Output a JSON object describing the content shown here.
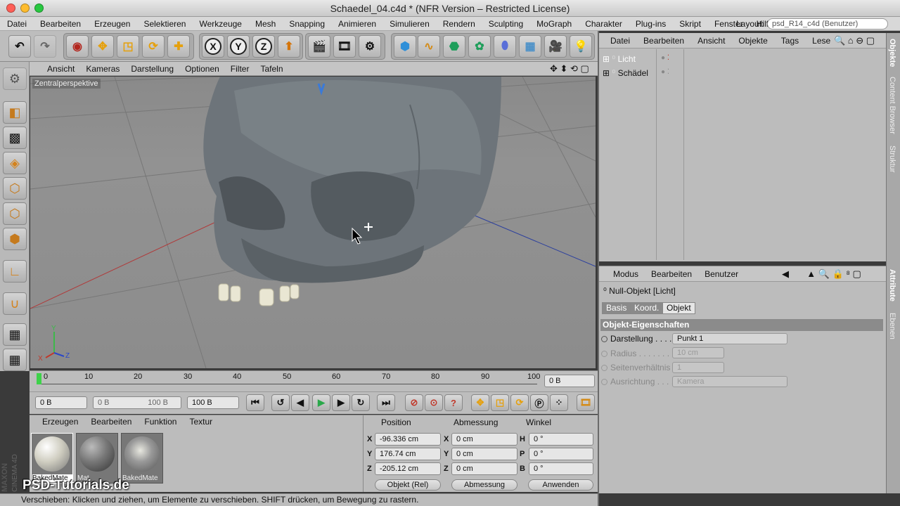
{
  "window": {
    "title": "Schaedel_04.c4d * (NFR Version – Restricted License)"
  },
  "menubar": {
    "items": [
      "Datei",
      "Bearbeiten",
      "Erzeugen",
      "Selektieren",
      "Werkzeuge",
      "Mesh",
      "Snapping",
      "Animieren",
      "Simulieren",
      "Rendern",
      "Sculpting",
      "MoGraph",
      "Charakter",
      "Plug-ins",
      "Skript",
      "Fenster",
      "Hilfe"
    ],
    "layout_label": "Layout:",
    "layout_value": "psd_R14_c4d (Benutzer)"
  },
  "toolbar": {
    "icons": [
      "undo-icon",
      "redo-icon",
      "select-icon",
      "move-icon",
      "scale-icon",
      "rotate-icon",
      "live-select-icon",
      "x-axis-icon",
      "y-axis-icon",
      "z-axis-icon",
      "coordinate-system-icon",
      "render-view-icon",
      "render-picture-viewer-icon",
      "render-settings-icon",
      "cube-icon",
      "spline-icon",
      "subdivision-icon",
      "array-icon",
      "deformer-icon",
      "floor-icon",
      "camera-icon",
      "light-icon"
    ],
    "axis_labels": [
      "X",
      "Y",
      "Z"
    ]
  },
  "viewport": {
    "menu": [
      "Ansicht",
      "Kameras",
      "Darstellung",
      "Optionen",
      "Filter",
      "Tafeln"
    ],
    "label": "Zentralperspektive",
    "axis_labels": {
      "x": "X",
      "y": "Y",
      "z": "Z"
    }
  },
  "timeline": {
    "ticks": [
      "0",
      "10",
      "20",
      "30",
      "40",
      "50",
      "60",
      "70",
      "80",
      "90",
      "100"
    ],
    "current_frame": "0 B"
  },
  "playback": {
    "start": "0 B",
    "range_start": "0 B",
    "range_end": "100 B",
    "end": "100 B"
  },
  "material_manager": {
    "menu": [
      "Erzeugen",
      "Bearbeiten",
      "Funktion",
      "Textur"
    ],
    "materials": [
      {
        "name": "BakedMate"
      },
      {
        "name": "Mat"
      },
      {
        "name": "BakedMate"
      }
    ]
  },
  "coordinates": {
    "headers": [
      "Position",
      "Abmessung",
      "Winkel"
    ],
    "rows": [
      {
        "axis": "X",
        "position": "-96.336 cm",
        "size_axis": "X",
        "size": "0 cm",
        "angle_axis": "H",
        "angle": "0 °"
      },
      {
        "axis": "Y",
        "position": "176.74 cm",
        "size_axis": "Y",
        "size": "0 cm",
        "angle_axis": "P",
        "angle": "0 °"
      },
      {
        "axis": "Z",
        "position": "-205.12 cm",
        "size_axis": "Z",
        "size": "0 cm",
        "angle_axis": "B",
        "angle": "0 °"
      }
    ],
    "mode": "Objekt (Rel)",
    "size_mode": "Abmessung",
    "apply": "Anwenden"
  },
  "object_manager": {
    "menu": [
      "Datei",
      "Bearbeiten",
      "Ansicht",
      "Objekte",
      "Tags",
      "Lese"
    ],
    "objects": [
      {
        "name": "Licht",
        "selected": true
      },
      {
        "name": "Schädel",
        "selected": false
      }
    ]
  },
  "attributes": {
    "menu": [
      "Modus",
      "Bearbeiten",
      "Benutzer"
    ],
    "object_title": "Null-Objekt [Licht]",
    "tabs": [
      "Basis",
      "Koord.",
      "Objekt"
    ],
    "active_tab": "Objekt",
    "section": "Objekt-Eigenschaften",
    "props": [
      {
        "label": "Darstellung . . . .",
        "value": "Punkt 1",
        "enabled": true
      },
      {
        "label": "Radius . . . . . . . .",
        "value": "10 cm",
        "enabled": false
      },
      {
        "label": "Seitenverhältnis .",
        "value": "1",
        "enabled": false
      },
      {
        "label": "Ausrichtung . . . .",
        "value": "Kamera",
        "enabled": false
      }
    ]
  },
  "side_tabs": [
    "Objekte",
    "Content Browser",
    "Struktur",
    "Attribute",
    "Ebenen"
  ],
  "statusbar": {
    "text": "Verschieben: Klicken und ziehen, um Elemente zu verschieben. SHIFT drücken, um Bewegung zu rastern."
  },
  "branding": {
    "watermark": "PSD-Tutorials.de",
    "vendor": "MAXON CINEMA 4D"
  },
  "colors": {
    "accent_x": "#c0392b",
    "accent_y": "#3db84a",
    "accent_z": "#2a47c8",
    "selected_object": "#ffffff"
  }
}
